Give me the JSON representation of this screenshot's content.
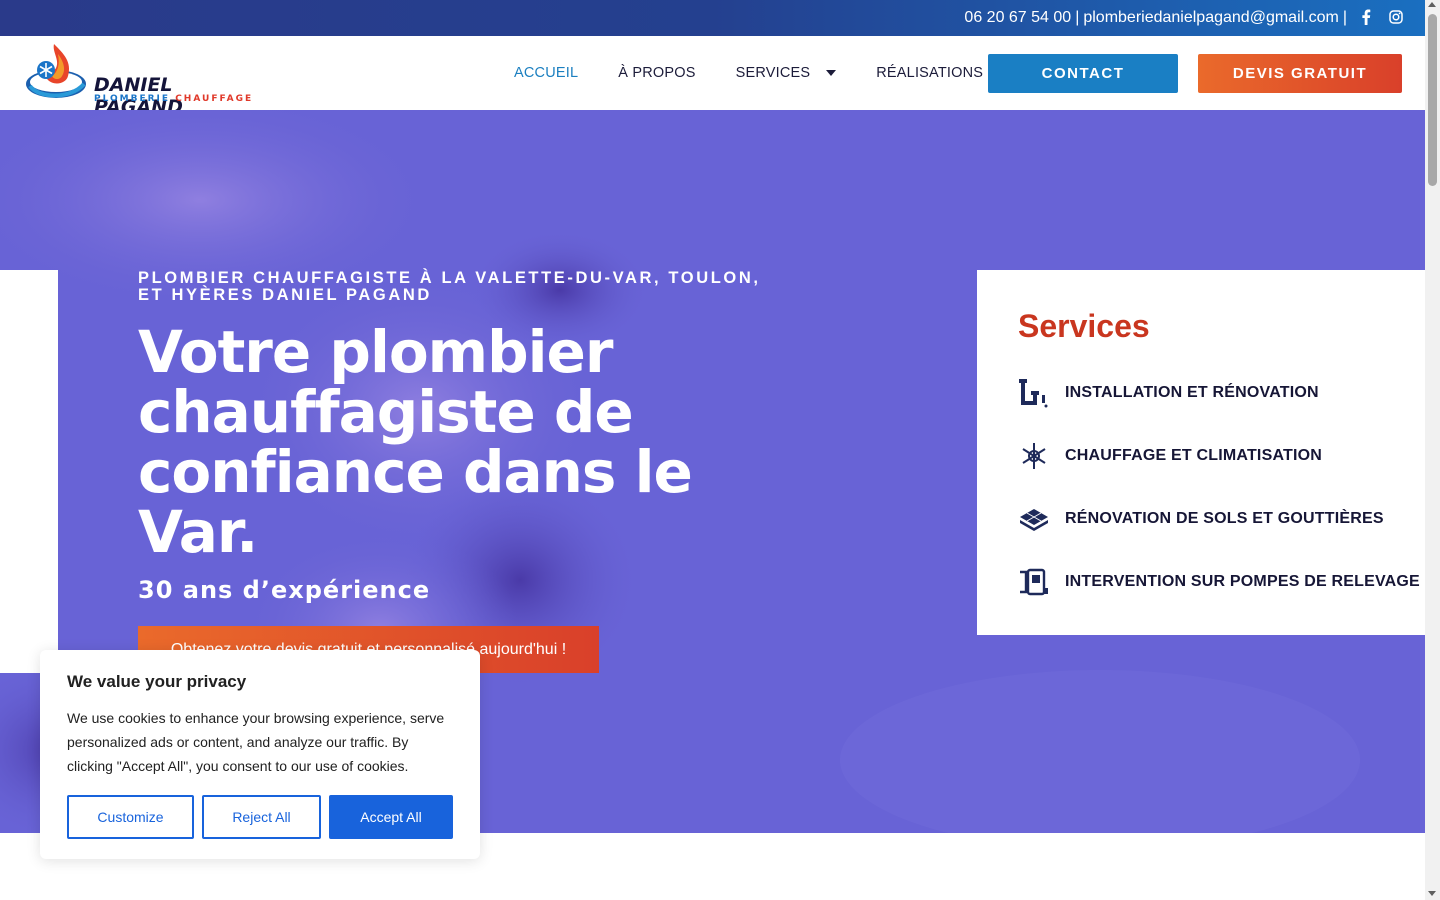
{
  "topbar": {
    "phone": "06 20 67 54 00",
    "separator": "|",
    "email": "plomberiedanielpagand@gmail.com",
    "separator2": "|",
    "facebook_icon": "facebook-icon",
    "instagram_icon": "instagram-icon"
  },
  "logo": {
    "name": "DANIEL PAGAND",
    "sub1": "PLOMBERIE",
    "sub2": "CHAUFFAGE"
  },
  "nav": {
    "items": [
      {
        "label": "ACCUEIL",
        "active": true
      },
      {
        "label": "À PROPOS"
      },
      {
        "label": "SERVICES",
        "has_dropdown": true
      },
      {
        "label": "RÉALISATIONS"
      }
    ],
    "contact_button": "CONTACT",
    "devis_button": "DEVIS GRATUIT"
  },
  "hero": {
    "tagline": "PLOMBIER CHAUFFAGISTE À LA VALETTE-DU-VAR, TOULON, ET HYÈRES DANIEL PAGAND",
    "headline": "Votre plombier chauffagiste de confiance dans le Var.",
    "years": "30 ans d’expérience",
    "cta": "Obtenez votre devis gratuit et personnalisé aujourd'hui !"
  },
  "services": {
    "title": "Services",
    "items": [
      {
        "label": "INSTALLATION ET RÉNOVATION",
        "icon": "pipe-icon"
      },
      {
        "label": "CHAUFFAGE ET CLIMATISATION",
        "icon": "snowflake-sun-icon"
      },
      {
        "label": "RÉNOVATION DE SOLS ET GOUTTIÈRES",
        "icon": "floor-tiles-icon"
      },
      {
        "label": "INTERVENTION SUR POMPES DE RELEVAGE",
        "icon": "pump-icon"
      }
    ]
  },
  "cookie": {
    "title": "We value your privacy",
    "body": "We use cookies to enhance your browsing experience, serve personalized ads or content, and analyze our traffic. By clicking \"Accept All\", you consent to our use of cookies.",
    "customize": "Customize",
    "reject": "Reject All",
    "accept": "Accept All"
  },
  "colors": {
    "brand_blue": "#1a7fc4",
    "brand_orange": "#ea6a2b",
    "hero_overlay": "#6862d4",
    "services_title": "#c9361f",
    "cookie_blue": "#1863dc"
  }
}
